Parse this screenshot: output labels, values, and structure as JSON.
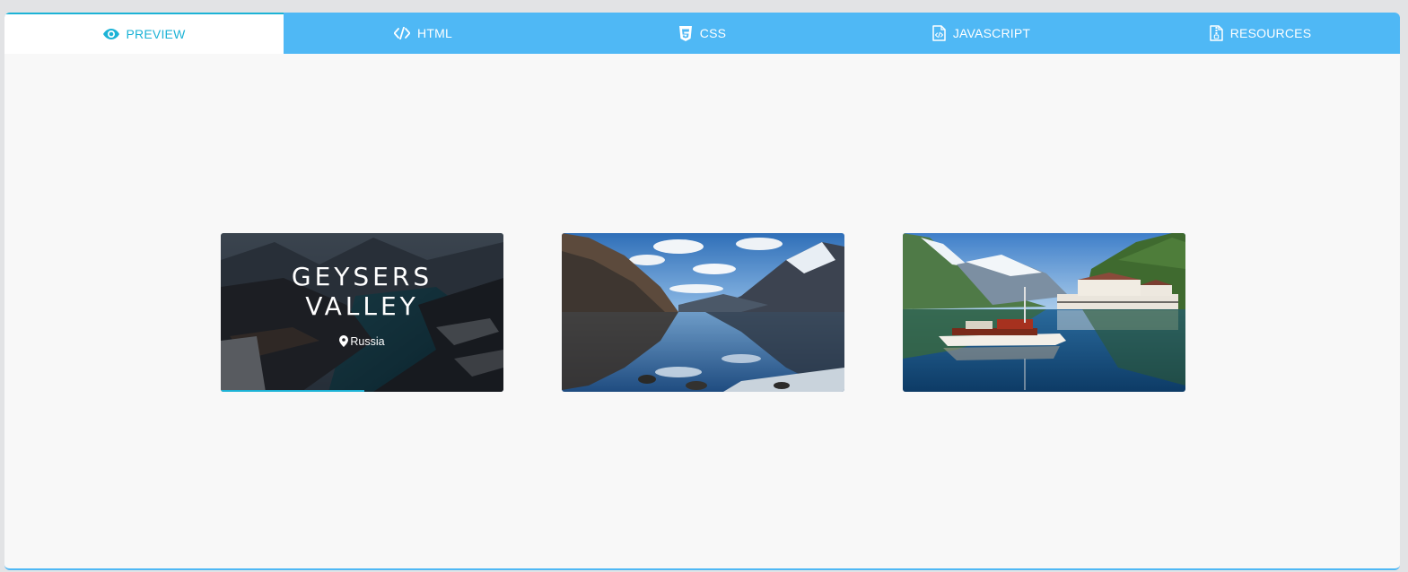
{
  "tabs": [
    {
      "label": "PREVIEW",
      "icon": "eye-icon",
      "active": true
    },
    {
      "label": "HTML",
      "icon": "code-icon",
      "active": false
    },
    {
      "label": "CSS",
      "icon": "css3-icon",
      "active": false
    },
    {
      "label": "JAVASCRIPT",
      "icon": "js-file-icon",
      "active": false
    },
    {
      "label": "RESOURCES",
      "icon": "resources-file-icon",
      "active": false
    }
  ],
  "colors": {
    "tab_bar": "#4fb8f5",
    "active_accent": "#1cb3d6",
    "stage_bg": "#f8f8f8"
  },
  "cards": [
    {
      "title_line1": "GEYSERS",
      "title_line2": "VALLEY",
      "location": "Russia",
      "location_icon": "map-pin-icon",
      "image": "mountain-lake-fjord-dark",
      "hovered": true
    },
    {
      "image": "mountain-lake-reflection",
      "hovered": false
    },
    {
      "image": "fjord-boat-and-hotel",
      "hovered": false
    }
  ]
}
